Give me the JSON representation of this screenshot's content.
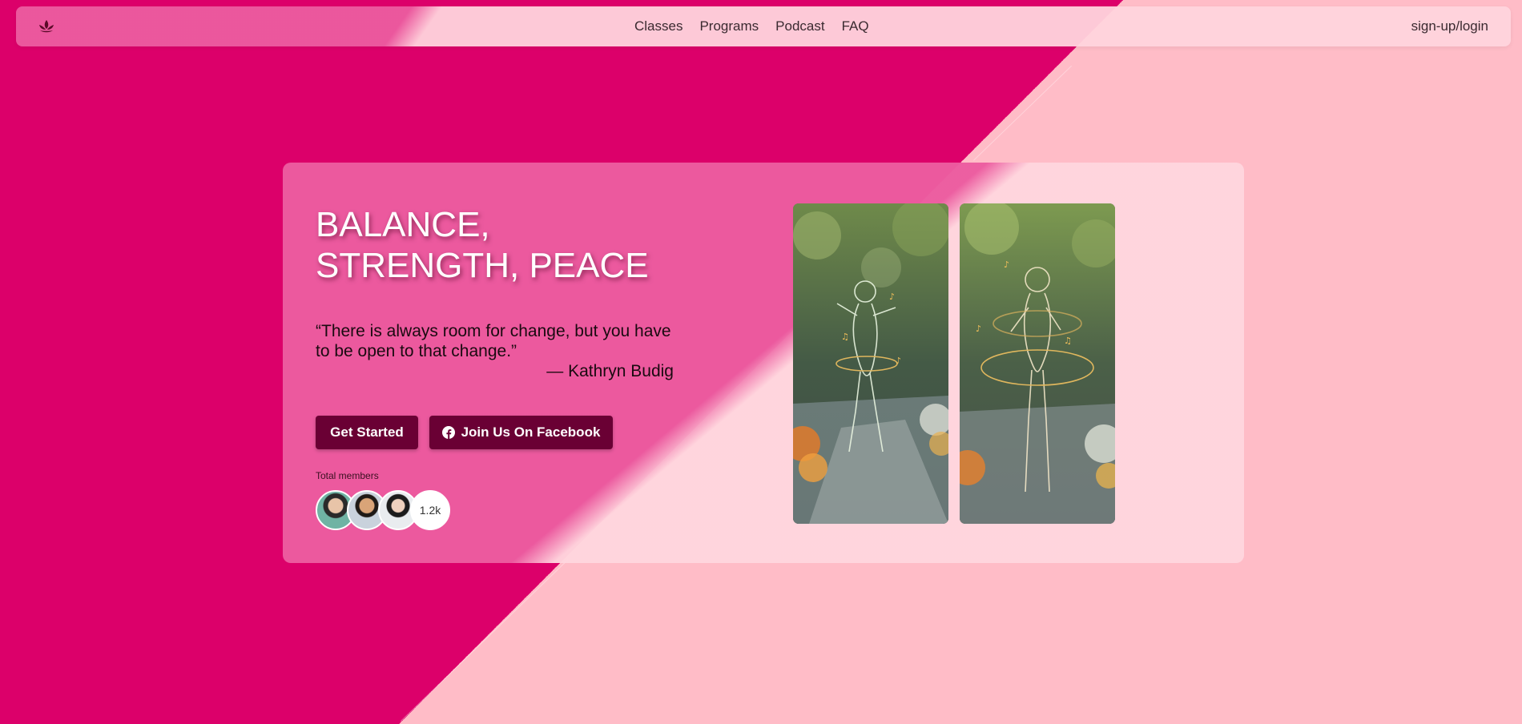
{
  "nav": {
    "logo_icon": "lotus-icon",
    "links": [
      "Classes",
      "Programs",
      "Podcast",
      "FAQ"
    ],
    "login_label": "sign-up/login"
  },
  "hero": {
    "title": "BALANCE, STRENGTH, PEACE",
    "quote": "“There is always room for change, but you have to be open to that change.”",
    "quote_author": "— Kathryn Budig",
    "buttons": {
      "get_started": "Get Started",
      "facebook": "Join Us On Facebook",
      "facebook_icon": "facebook-icon"
    },
    "members": {
      "label": "Total members",
      "count": "1.2k"
    },
    "images": [
      "glowing-dancer-image-1",
      "glowing-dancer-image-2"
    ]
  },
  "colors": {
    "accent": "#dc006a",
    "accent_light": "#ffbcc7",
    "button": "#6a0034"
  }
}
